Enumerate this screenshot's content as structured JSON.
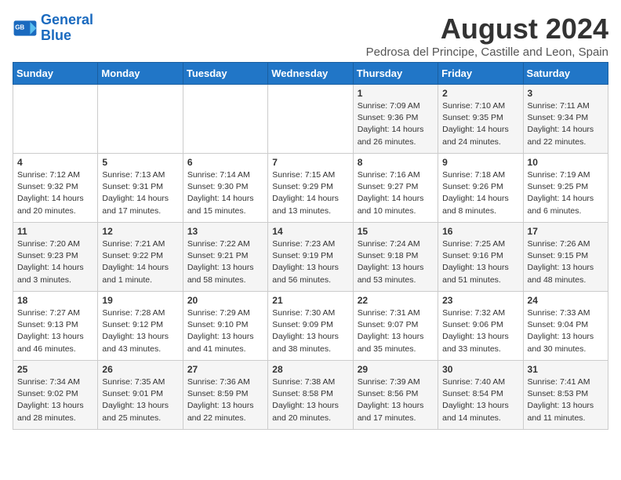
{
  "logo": {
    "line1": "General",
    "line2": "Blue"
  },
  "title": "August 2024",
  "location": "Pedrosa del Principe, Castille and Leon, Spain",
  "weekdays": [
    "Sunday",
    "Monday",
    "Tuesday",
    "Wednesday",
    "Thursday",
    "Friday",
    "Saturday"
  ],
  "weeks": [
    [
      {
        "day": "",
        "info": ""
      },
      {
        "day": "",
        "info": ""
      },
      {
        "day": "",
        "info": ""
      },
      {
        "day": "",
        "info": ""
      },
      {
        "day": "1",
        "info": "Sunrise: 7:09 AM\nSunset: 9:36 PM\nDaylight: 14 hours\nand 26 minutes."
      },
      {
        "day": "2",
        "info": "Sunrise: 7:10 AM\nSunset: 9:35 PM\nDaylight: 14 hours\nand 24 minutes."
      },
      {
        "day": "3",
        "info": "Sunrise: 7:11 AM\nSunset: 9:34 PM\nDaylight: 14 hours\nand 22 minutes."
      }
    ],
    [
      {
        "day": "4",
        "info": "Sunrise: 7:12 AM\nSunset: 9:32 PM\nDaylight: 14 hours\nand 20 minutes."
      },
      {
        "day": "5",
        "info": "Sunrise: 7:13 AM\nSunset: 9:31 PM\nDaylight: 14 hours\nand 17 minutes."
      },
      {
        "day": "6",
        "info": "Sunrise: 7:14 AM\nSunset: 9:30 PM\nDaylight: 14 hours\nand 15 minutes."
      },
      {
        "day": "7",
        "info": "Sunrise: 7:15 AM\nSunset: 9:29 PM\nDaylight: 14 hours\nand 13 minutes."
      },
      {
        "day": "8",
        "info": "Sunrise: 7:16 AM\nSunset: 9:27 PM\nDaylight: 14 hours\nand 10 minutes."
      },
      {
        "day": "9",
        "info": "Sunrise: 7:18 AM\nSunset: 9:26 PM\nDaylight: 14 hours\nand 8 minutes."
      },
      {
        "day": "10",
        "info": "Sunrise: 7:19 AM\nSunset: 9:25 PM\nDaylight: 14 hours\nand 6 minutes."
      }
    ],
    [
      {
        "day": "11",
        "info": "Sunrise: 7:20 AM\nSunset: 9:23 PM\nDaylight: 14 hours\nand 3 minutes."
      },
      {
        "day": "12",
        "info": "Sunrise: 7:21 AM\nSunset: 9:22 PM\nDaylight: 14 hours\nand 1 minute."
      },
      {
        "day": "13",
        "info": "Sunrise: 7:22 AM\nSunset: 9:21 PM\nDaylight: 13 hours\nand 58 minutes."
      },
      {
        "day": "14",
        "info": "Sunrise: 7:23 AM\nSunset: 9:19 PM\nDaylight: 13 hours\nand 56 minutes."
      },
      {
        "day": "15",
        "info": "Sunrise: 7:24 AM\nSunset: 9:18 PM\nDaylight: 13 hours\nand 53 minutes."
      },
      {
        "day": "16",
        "info": "Sunrise: 7:25 AM\nSunset: 9:16 PM\nDaylight: 13 hours\nand 51 minutes."
      },
      {
        "day": "17",
        "info": "Sunrise: 7:26 AM\nSunset: 9:15 PM\nDaylight: 13 hours\nand 48 minutes."
      }
    ],
    [
      {
        "day": "18",
        "info": "Sunrise: 7:27 AM\nSunset: 9:13 PM\nDaylight: 13 hours\nand 46 minutes."
      },
      {
        "day": "19",
        "info": "Sunrise: 7:28 AM\nSunset: 9:12 PM\nDaylight: 13 hours\nand 43 minutes."
      },
      {
        "day": "20",
        "info": "Sunrise: 7:29 AM\nSunset: 9:10 PM\nDaylight: 13 hours\nand 41 minutes."
      },
      {
        "day": "21",
        "info": "Sunrise: 7:30 AM\nSunset: 9:09 PM\nDaylight: 13 hours\nand 38 minutes."
      },
      {
        "day": "22",
        "info": "Sunrise: 7:31 AM\nSunset: 9:07 PM\nDaylight: 13 hours\nand 35 minutes."
      },
      {
        "day": "23",
        "info": "Sunrise: 7:32 AM\nSunset: 9:06 PM\nDaylight: 13 hours\nand 33 minutes."
      },
      {
        "day": "24",
        "info": "Sunrise: 7:33 AM\nSunset: 9:04 PM\nDaylight: 13 hours\nand 30 minutes."
      }
    ],
    [
      {
        "day": "25",
        "info": "Sunrise: 7:34 AM\nSunset: 9:02 PM\nDaylight: 13 hours\nand 28 minutes."
      },
      {
        "day": "26",
        "info": "Sunrise: 7:35 AM\nSunset: 9:01 PM\nDaylight: 13 hours\nand 25 minutes."
      },
      {
        "day": "27",
        "info": "Sunrise: 7:36 AM\nSunset: 8:59 PM\nDaylight: 13 hours\nand 22 minutes."
      },
      {
        "day": "28",
        "info": "Sunrise: 7:38 AM\nSunset: 8:58 PM\nDaylight: 13 hours\nand 20 minutes."
      },
      {
        "day": "29",
        "info": "Sunrise: 7:39 AM\nSunset: 8:56 PM\nDaylight: 13 hours\nand 17 minutes."
      },
      {
        "day": "30",
        "info": "Sunrise: 7:40 AM\nSunset: 8:54 PM\nDaylight: 13 hours\nand 14 minutes."
      },
      {
        "day": "31",
        "info": "Sunrise: 7:41 AM\nSunset: 8:53 PM\nDaylight: 13 hours\nand 11 minutes."
      }
    ]
  ]
}
